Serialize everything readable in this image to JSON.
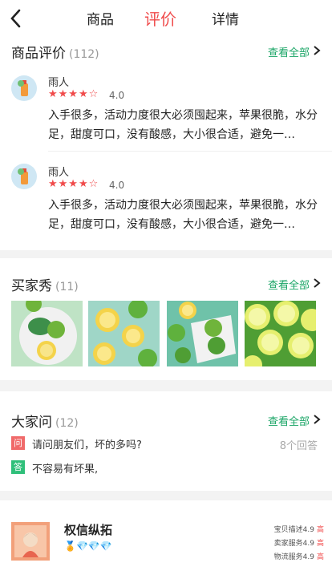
{
  "nav": {
    "back_icon": "chevron-left-icon",
    "tabs": [
      {
        "label": "商品",
        "active": false
      },
      {
        "label": "评价",
        "active": true
      },
      {
        "label": "详情",
        "active": false
      }
    ]
  },
  "reviews": {
    "title": "商品评价",
    "count": "(112)",
    "see_all": "查看全部",
    "items": [
      {
        "user": "雨人",
        "stars": "★★★★☆",
        "rating": "4.0",
        "text": "入手很多，活动力度很大必须囤起来，苹果很脆，水分足，甜度可口，没有酸感，大小很合适，避免一…"
      },
      {
        "user": "雨人",
        "stars": "★★★★☆",
        "rating": "4.0",
        "text": "入手很多，活动力度很大必须囤起来，苹果很脆，水分足，甜度可口，没有酸感，大小很合适，避免一…"
      }
    ]
  },
  "buyer_show": {
    "title": "买家秀",
    "count": "(11)",
    "see_all": "查看全部"
  },
  "qa": {
    "title": "大家问",
    "count": "(12)",
    "see_all": "查看全部",
    "question_tag": "问",
    "question": "请问朋友们，坏的多吗?",
    "answer_count": "8个回答",
    "answer_tag": "答",
    "answer": "不容易有坏果,"
  },
  "shop": {
    "name": "权信纵拓",
    "badges": "💎💎💎",
    "scores": [
      {
        "label": "宝贝描述4.9",
        "flag": "高"
      },
      {
        "label": "卖家服务4.9",
        "flag": "高"
      },
      {
        "label": "物流服务4.9",
        "flag": "高"
      }
    ]
  },
  "colors": {
    "accent_red": "#f04b4b",
    "accent_green": "#1aa566"
  }
}
